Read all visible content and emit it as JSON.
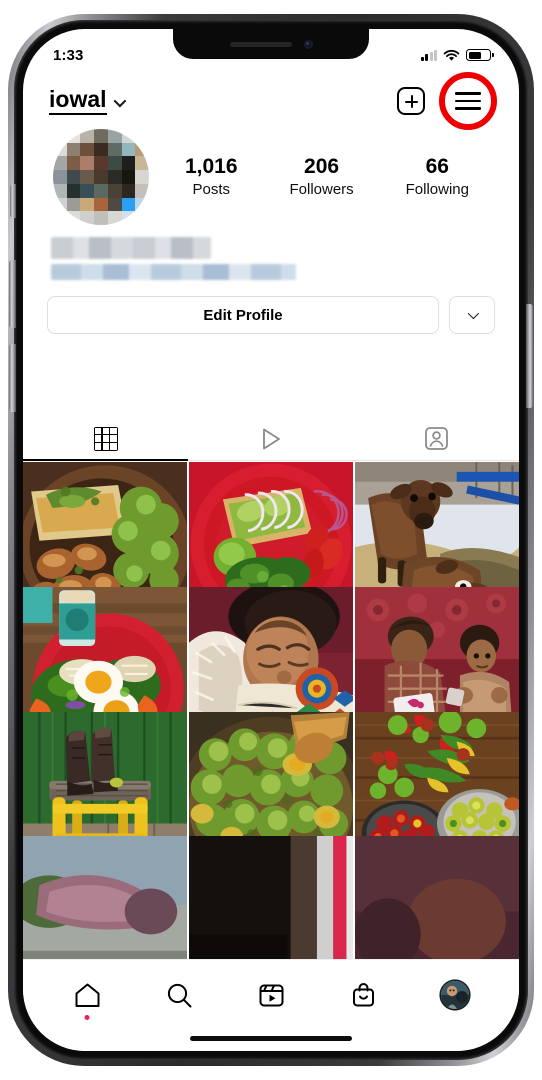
{
  "device": {
    "name": "iphone-x-frame",
    "notch": {
      "speaker": "earpiece-speaker",
      "camera": "front-camera"
    },
    "buttons": [
      "silent-switch",
      "volume-up",
      "volume-down",
      "power-button"
    ]
  },
  "status_bar": {
    "time": "1:33",
    "signal_icon": "cellular-signal-icon",
    "signal_bars_filled": 2,
    "signal_bars_total": 4,
    "wifi_icon": "wifi-icon",
    "battery_icon": "battery-icon",
    "battery_level_percent": 62
  },
  "header": {
    "username": "iowal",
    "username_chevron_icon": "chevron-down-icon",
    "new_post_icon": "plus-square-icon",
    "menu_icon": "hamburger-menu-icon",
    "highlight_color": "#ee0000",
    "highlight_shape": "circle-ring"
  },
  "profile": {
    "avatar_name": "profile-avatar-blurred",
    "avatar_blurred": true,
    "bio_blurred": true,
    "stats": [
      {
        "value": "1,016",
        "label": "Posts"
      },
      {
        "value": "206",
        "label": "Followers"
      },
      {
        "value": "66",
        "label": "Following"
      }
    ],
    "edit_profile_label": "Edit Profile",
    "dropdown_icon": "chevron-down-icon"
  },
  "tabs": [
    {
      "name": "tab-grid",
      "icon": "grid-icon",
      "active": true
    },
    {
      "name": "tab-reels",
      "icon": "play-triangle-icon",
      "active": false
    },
    {
      "name": "tab-tagged",
      "icon": "tagged-person-icon",
      "active": false
    }
  ],
  "photo_grid": {
    "columns": 3,
    "photos": [
      {
        "alt": "roasted-potatoes-and-broccoli-on-dark-plate"
      },
      {
        "alt": "avocado-toast-with-onion-tomato-kale-on-red-plate"
      },
      {
        "alt": "brown-calf-eating-hay-in-snow"
      },
      {
        "alt": "salad-with-boiled-eggs-on-red-plate"
      },
      {
        "alt": "sleeping-child-wrapped-in-blanket"
      },
      {
        "alt": "two-children-reading-on-red-couch"
      },
      {
        "alt": "boots-on-yellow-stool-green-wall"
      },
      {
        "alt": "pan-of-green-tomatoes-with-wooden-spoon"
      },
      {
        "alt": "bowls-of-tomatoes-and-peppers-on-wood-table"
      },
      {
        "alt": "partial-row-hands-and-basket"
      },
      {
        "alt": "partial-row-dark-scene"
      },
      {
        "alt": "partial-row-maroon-scene"
      }
    ]
  },
  "bottom_nav": {
    "items": [
      {
        "name": "nav-home",
        "icon": "home-icon",
        "badge": true
      },
      {
        "name": "nav-search",
        "icon": "search-icon",
        "badge": false
      },
      {
        "name": "nav-reels",
        "icon": "reels-icon",
        "badge": false
      },
      {
        "name": "nav-shop",
        "icon": "shop-bag-icon",
        "badge": false
      },
      {
        "name": "nav-profile",
        "icon": "profile-avatar-icon",
        "badge": false
      }
    ],
    "badge_color": "#e8215a"
  }
}
